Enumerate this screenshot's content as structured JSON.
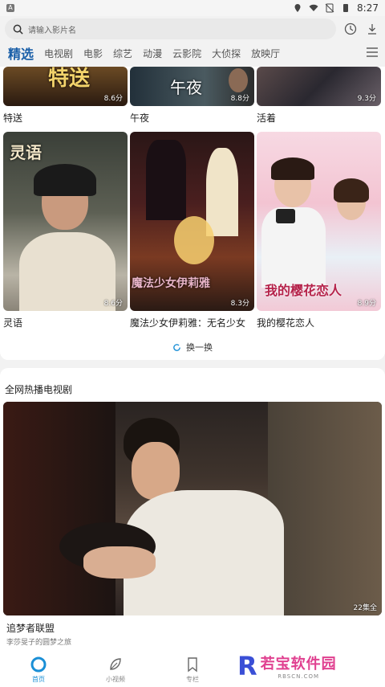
{
  "status_bar": {
    "time": "8:27"
  },
  "search": {
    "placeholder": "请输入影片名"
  },
  "tabs": [
    "精选",
    "电视剧",
    "电影",
    "综艺",
    "动漫",
    "云影院",
    "大侦探",
    "放映厅"
  ],
  "row1": [
    {
      "title": "特送",
      "score": "8.6分",
      "poster_text": "特送"
    },
    {
      "title": "午夜",
      "score": "8.8分",
      "poster_text": "午夜"
    },
    {
      "title": "活着",
      "score": "9.3分",
      "poster_text": ""
    }
  ],
  "row2": [
    {
      "title": "灵语",
      "score": "8.6分",
      "poster_text": "灵语"
    },
    {
      "title": "魔法少女伊莉雅：无名少女",
      "score": "8.3分",
      "poster_text": "魔法少女伊莉雅"
    },
    {
      "title": "我的樱花恋人",
      "score": "8.9分",
      "poster_text": "我的樱花恋人"
    }
  ],
  "refresh_label": "换一换",
  "hot": {
    "section_title": "全网热播电视剧",
    "name": "追梦者联盟",
    "subtitle": "李莎旻子的圆梦之旅",
    "episodes": "22集全"
  },
  "nav": [
    {
      "label": "首页",
      "icon": "home-icon"
    },
    {
      "label": "小视频",
      "icon": "leaf-icon"
    },
    {
      "label": "专栏",
      "icon": "bookmark-icon"
    }
  ],
  "watermark": {
    "main": "若宝软件园",
    "sub": "RBSCN.COM",
    "logo": "R"
  },
  "colors": {
    "accent": "#1a5fa8",
    "nav_active": "#1a8fd6"
  }
}
